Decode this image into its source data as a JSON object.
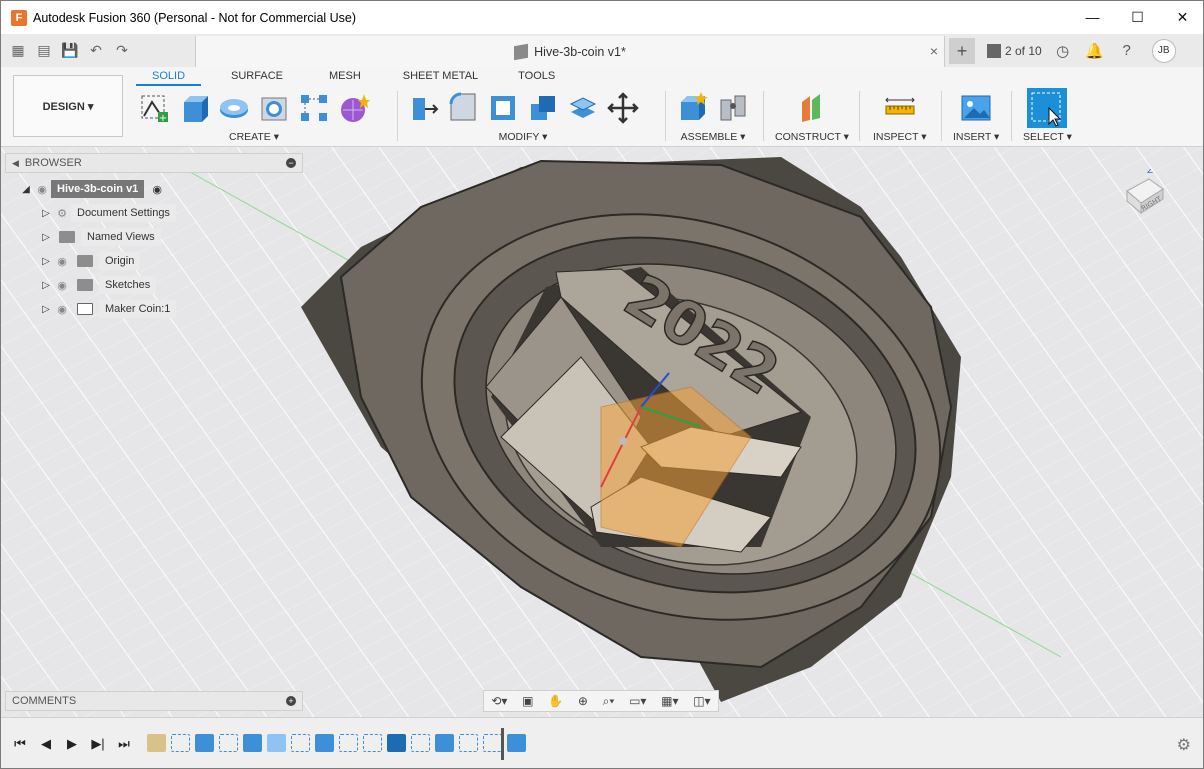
{
  "window": {
    "title": "Autodesk Fusion 360 (Personal - Not for Commercial Use)",
    "minimize": "—",
    "maximize": "☐",
    "close": "✕"
  },
  "tabbar": {
    "doc_title": "Hive-3b-coin v1*",
    "doc_close": "×",
    "new_tab": "+",
    "version": "2 of 10",
    "user": "JB"
  },
  "toolbar": {
    "workspace": "DESIGN ▾",
    "tabs": [
      "SOLID",
      "SURFACE",
      "MESH",
      "SHEET METAL",
      "TOOLS"
    ],
    "groups": {
      "create": "CREATE ▾",
      "modify": "MODIFY ▾",
      "assemble": "ASSEMBLE ▾",
      "construct": "CONSTRUCT ▾",
      "inspect": "INSPECT ▾",
      "insert": "INSERT ▾",
      "select": "SELECT ▾"
    }
  },
  "browser": {
    "title": "BROWSER",
    "items": [
      {
        "label": "Hive-3b-coin v1"
      },
      {
        "label": "Document Settings"
      },
      {
        "label": "Named Views"
      },
      {
        "label": "Origin"
      },
      {
        "label": "Sketches"
      },
      {
        "label": "Maker Coin:1"
      }
    ]
  },
  "comments": {
    "title": "COMMENTS"
  },
  "viewcube": {
    "face": "RIGHT",
    "edge": "Z"
  },
  "model": {
    "emboss_text": "2022"
  },
  "colors": {
    "accent": "#1b7fd1",
    "model": "#6e6860",
    "highlight": "#f2a13a"
  }
}
